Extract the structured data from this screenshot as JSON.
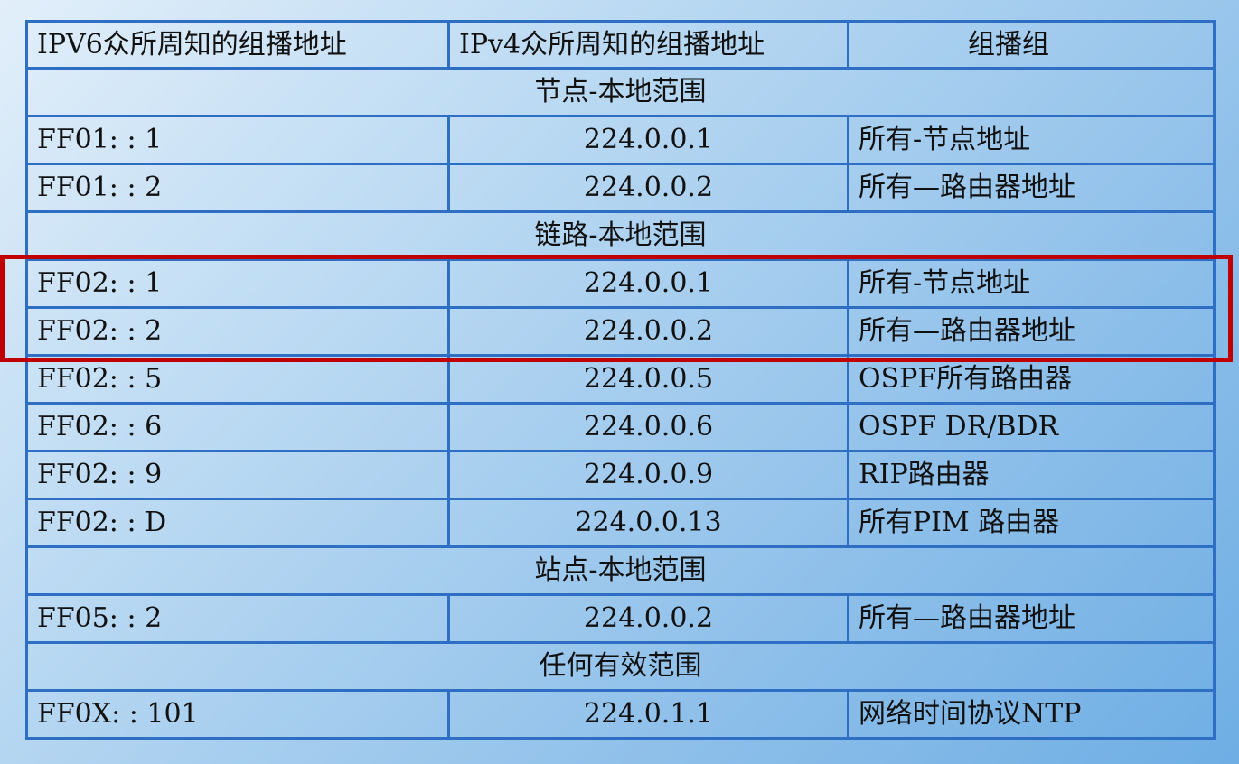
{
  "headers": {
    "ipv6": "IPV6众所周知的组播地址",
    "ipv4": "IPv4众所周知的组播地址",
    "group": "组播组"
  },
  "sections": [
    {
      "title": "节点-本地范围",
      "rows": [
        {
          "ipv6": "FF01: : 1",
          "ipv4": "224.0.0.1",
          "group": "所有-节点地址"
        },
        {
          "ipv6": "FF01: : 2",
          "ipv4": "224.0.0.2",
          "group": "所有—路由器地址"
        }
      ]
    },
    {
      "title": "链路-本地范围",
      "rows": [
        {
          "ipv6": "FF02: : 1",
          "ipv4": "224.0.0.1",
          "group": "所有-节点地址"
        },
        {
          "ipv6": "FF02: : 2",
          "ipv4": "224.0.0.2",
          "group": "所有—路由器地址"
        },
        {
          "ipv6": "FF02: : 5",
          "ipv4": "224.0.0.5",
          "group": "OSPF所有路由器"
        },
        {
          "ipv6": "FF02: : 6",
          "ipv4": "224.0.0.6",
          "group": "OSPF DR/BDR"
        },
        {
          "ipv6": "FF02: : 9",
          "ipv4": "224.0.0.9",
          "group": "RIP路由器"
        },
        {
          "ipv6": "FF02: : D",
          "ipv4": "224.0.0.13",
          "group": "所有PIM 路由器"
        }
      ]
    },
    {
      "title": "站点-本地范围",
      "rows": [
        {
          "ipv6": "FF05: : 2",
          "ipv4": "224.0.0.2",
          "group": "所有—路由器地址"
        }
      ]
    },
    {
      "title": "任何有效范围",
      "rows": [
        {
          "ipv6": "FF0X: : 101",
          "ipv4": "224.0.1.1",
          "group": "网络时间协议NTP"
        }
      ]
    }
  ],
  "colors": {
    "border": "#2e6fc4",
    "highlight": "#c00000"
  }
}
